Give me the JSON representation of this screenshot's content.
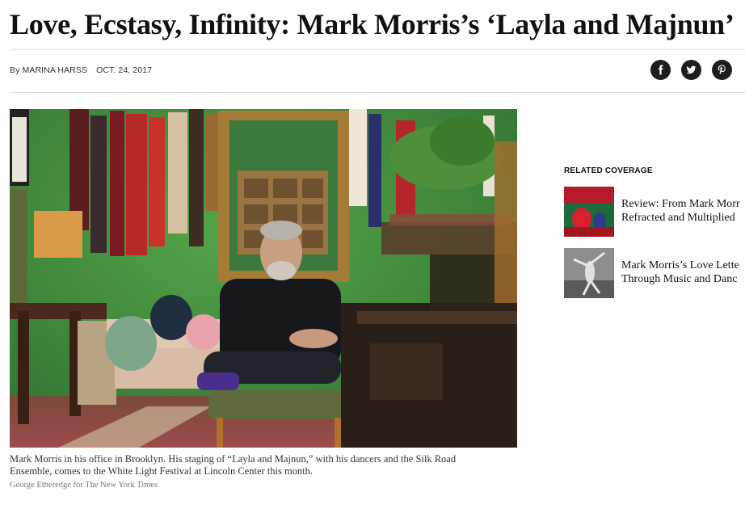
{
  "article": {
    "headline": "Love, Ecstasy, Infinity: Mark Morris’s ‘Layla and Majnun’",
    "byline_prefix": "By",
    "author": "MARINA HARSS",
    "date": "OCT. 24, 2017"
  },
  "share": {
    "buttons": [
      {
        "icon": "facebook-icon"
      },
      {
        "icon": "twitter-icon"
      },
      {
        "icon": "pinterest-icon"
      }
    ]
  },
  "photo": {
    "caption": "Mark Morris in his office in Brooklyn. His staging of “Layla and Majnun,” with his dancers and the Silk Road Ensemble, comes to the White Light Festival at Lincoln Center this month.",
    "credit": "George Etheredge for The New York Times"
  },
  "related": {
    "heading": "RELATED COVERAGE",
    "items": [
      {
        "line1": "Review: From Mark Morr",
        "line2": "Refracted and Multiplied"
      },
      {
        "line1": "Mark Morris’s Love Lette",
        "line2": "Through Music and Danc"
      }
    ]
  },
  "colors": {
    "wall_green": "#3d8a3e",
    "share_button": "#1d1d1d",
    "rule": "#e2e2e2"
  }
}
